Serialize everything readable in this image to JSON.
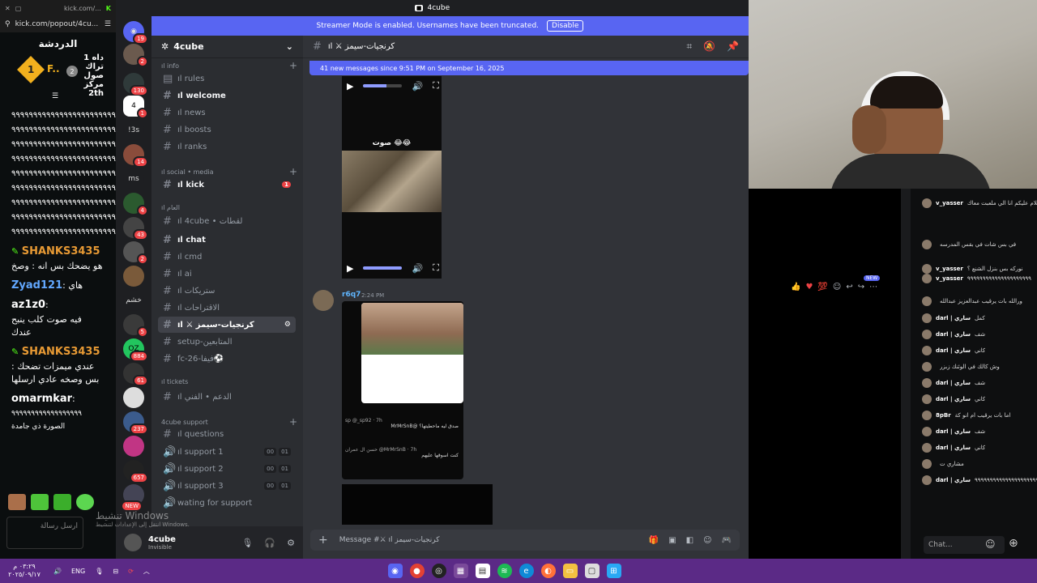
{
  "left_chat": {
    "tab_url": "kick.com/popout/4cu...",
    "tab_title": "kick.com/...",
    "header": "الدردشة",
    "leader": {
      "rank1": "1",
      "rank2": "2",
      "name1": "F..",
      "side_text": "داه 1\nتراك\nصول\nمركز\n2th"
    },
    "spam_line": "٩٩٩٩٩٩٩٩٩٩٩٩٩٩٩٩٩٩٩٩٩٩٩٩٩٩٩",
    "messages": [
      {
        "user": "SHANKS3435",
        "text": "هو يضحك بس انه : وصخ",
        "color": "#e89a34"
      },
      {
        "user": "Zyad121",
        "text": "هاي",
        "color": "#62a8ff"
      },
      {
        "user": "az1z0",
        "text": "فيه صوت كلب ينبح عندك",
        "color": "#ffffff"
      },
      {
        "user": "SHANKS3435",
        "text": "عندي ميمزات تضحك : بس وصخه عادي ارسلها",
        "color": "#e89a34"
      },
      {
        "user": "omarmkar",
        "text": "٩٩٩٩٩٩٩٩٩٩٩٩٩٩٩٩٩٩ الصورة ذي جامدة",
        "color": "#ffffff"
      }
    ],
    "send_hint": "ارسل رسالة"
  },
  "discord": {
    "window_title": "4cube",
    "streamer_banner": "Streamer Mode is enabled. Usernames have been truncated.",
    "disable_label": "Disable",
    "server_name": "4cube",
    "server_badges": [
      "19",
      "2",
      "130",
      "1",
      "!3s",
      "14",
      "ms",
      "4",
      "43",
      "2",
      "خشم",
      "5",
      "884",
      "61",
      "237",
      "657",
      "NEW"
    ],
    "categories": {
      "info": "ıl info",
      "social": "ıl social • media",
      "general": "ıl العام",
      "tickets": "ıl tickets",
      "support": "4cube support"
    },
    "channels": [
      {
        "label": "ıl rules",
        "bright": false
      },
      {
        "label": "ıl welcome",
        "bright": true
      },
      {
        "label": "ıl news",
        "bright": false
      },
      {
        "label": "ıl boosts",
        "bright": false
      },
      {
        "label": "ıl ranks",
        "bright": false
      },
      {
        "label": "ıl kick",
        "bright": true,
        "mention": "1"
      },
      {
        "label": "ıl 4cube • لقطات",
        "bright": false
      },
      {
        "label": "ıl chat",
        "bright": true
      },
      {
        "label": "ıl cmd",
        "bright": false
      },
      {
        "label": "ıl ai",
        "bright": false
      },
      {
        "label": "ıl ستريكات",
        "bright": false
      },
      {
        "label": "ıl الاقتراحات",
        "bright": false
      },
      {
        "label": "ıl ⚔ كرنجيات-سيمز",
        "bright": true,
        "selected": true
      },
      {
        "label": "setup-المتابعين",
        "bright": false
      },
      {
        "label": "fc-26-فيفا⚽",
        "bright": false
      },
      {
        "label": "ıl الدعم • الفني",
        "bright": false
      },
      {
        "label": "ıl questions",
        "bright": false
      },
      {
        "label": "ıl support 1",
        "bright": false,
        "counts": [
          "00",
          "01"
        ]
      },
      {
        "label": "ıl support 2",
        "bright": false,
        "counts": [
          "00",
          "01"
        ]
      },
      {
        "label": "ıl support 3",
        "bright": false,
        "counts": [
          "00",
          "01"
        ]
      },
      {
        "label": "wating for support",
        "bright": false
      }
    ],
    "user": {
      "name": "4cube",
      "status": "Invisible"
    },
    "channel_title": "ıl ⚔ كرنجيات-سيمز",
    "new_messages": "41 new messages since 9:51 PM on September 16, 2025",
    "post": {
      "author": "r6q7",
      "time": "2:24 PM",
      "new_badge": "NEW",
      "video_caption": "صوت 😂😂"
    },
    "tweet": {
      "reply1_user": "sp @_sp92 · 7h",
      "reply1_text": "صدق ليه ماحطيتها؟ @MrMrSnB",
      "reply2_user": "حسن ال عمران @MrMrSnB · 7h",
      "reply2_text": "كنت اسوقها عليهم"
    },
    "composer_placeholder": "Message #⚔ ıl كرنجيات-سيمز"
  },
  "right_chat": {
    "rows": [
      {
        "user": "v_yasser",
        "text": "السلام عليكم انا الي ملعبت معاك"
      },
      {
        "user": "",
        "text": "في بس شات في بقس المدرسه"
      },
      {
        "user": "v_yasser",
        "text": "نوركه بس بنزل الشنع ؟"
      },
      {
        "user": "v_yasser",
        "text": "٩٩٩٩٩٩٩٩٩٩٩٩٩٩٩٩٩٩٩٩٩"
      },
      {
        "user": "",
        "text": "ورالله بات يرقيب عبدالعزيز عبدالله"
      },
      {
        "user": "darl | ساري",
        "text": "كمل"
      },
      {
        "user": "darl | ساري",
        "text": "شف"
      },
      {
        "user": "darl | ساري",
        "text": "كاني"
      },
      {
        "user": "",
        "text": "وش كالك في الوئنك زبزر"
      },
      {
        "user": "darl | ساري",
        "text": "شف"
      },
      {
        "user": "darl | ساري",
        "text": "كاني"
      },
      {
        "user": "8pBr",
        "text": "اما بات يرقيب ام انو كة"
      },
      {
        "user": "darl | ساري",
        "text": "شف"
      },
      {
        "user": "darl | ساري",
        "text": "كاني"
      },
      {
        "user": "",
        "text": "مشاري ت"
      },
      {
        "user": "darl | ساري",
        "text": "٩٩٩٩٩٩٩٩٩٩٩٩٩٩٩٩٩٩٩٩٩٩"
      }
    ],
    "input_placeholder": "Chat..."
  },
  "windows": {
    "watermark_title": "تنشيط Windows",
    "watermark_sub": "انتقل إلى الإعدادات لتنشيط Windows.",
    "time": "٠٣:٢٩ م",
    "date": "٢٠٢٥/٠٩/١٧",
    "lang": "ENG"
  },
  "colors": {
    "blurple": "#5865f2",
    "taskbar": "#5b2a86",
    "kick_green": "#53fc18"
  }
}
